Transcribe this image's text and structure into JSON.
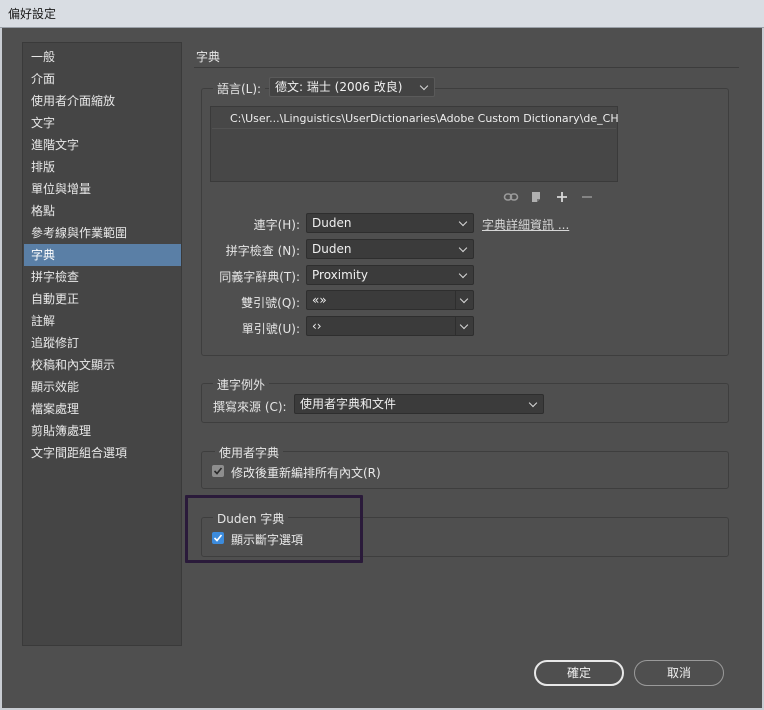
{
  "window": {
    "title": "偏好設定"
  },
  "sidebar": {
    "items": [
      {
        "label": "一般"
      },
      {
        "label": "介面"
      },
      {
        "label": "使用者介面縮放"
      },
      {
        "label": "文字"
      },
      {
        "label": "進階文字"
      },
      {
        "label": "排版"
      },
      {
        "label": "單位與增量"
      },
      {
        "label": "格點"
      },
      {
        "label": "參考線與作業範圍"
      },
      {
        "label": "字典",
        "selected": true
      },
      {
        "label": "拼字檢查"
      },
      {
        "label": "自動更正"
      },
      {
        "label": "註解"
      },
      {
        "label": "追蹤修訂"
      },
      {
        "label": "校稿和內文顯示"
      },
      {
        "label": "顯示效能"
      },
      {
        "label": "檔案處理"
      },
      {
        "label": "剪貼簿處理"
      },
      {
        "label": "文字間距組合選項"
      }
    ]
  },
  "panel": {
    "title": "字典",
    "language": {
      "label": "語言(L):",
      "value": "德文: 瑞士 (2006 改良)"
    },
    "dictionary_path": "C:\\User...\\Linguistics\\UserDictionaries\\Adobe Custom Dictionary\\de_CH",
    "tool_icons": [
      "link-icon",
      "page-icon",
      "plus-icon",
      "minus-icon"
    ],
    "hyphenation": {
      "label": "連字(H):",
      "value": "Duden"
    },
    "dictionary_info_link": "字典詳細資訊 ...",
    "spelling": {
      "label": "拼字檢查 (N):",
      "value": "Duden"
    },
    "thesaurus": {
      "label": "同義字辭典(T):",
      "value": "Proximity"
    },
    "double_quotes": {
      "label": "雙引號(Q):",
      "value": "«»"
    },
    "single_quotes": {
      "label": "單引號(U):",
      "value": "‹›"
    },
    "hyphenation_exceptions": {
      "group_label": "連字例外",
      "compose_label": "撰寫來源 (C):",
      "compose_value": "使用者字典和文件"
    },
    "user_dictionary": {
      "group_label": "使用者字典",
      "recompose_label": "修改後重新編排所有內文(R)",
      "recompose_checked": true
    },
    "duden": {
      "group_label": "Duden 字典",
      "show_hyphenation_label": "顯示斷字選項",
      "show_hyphenation_checked": true
    }
  },
  "buttons": {
    "ok": "確定",
    "cancel": "取消"
  },
  "colors": {
    "selection": "#5a7fa6",
    "checkbox_active": "#3c8bdc",
    "highlight": "#2a1a3a"
  }
}
